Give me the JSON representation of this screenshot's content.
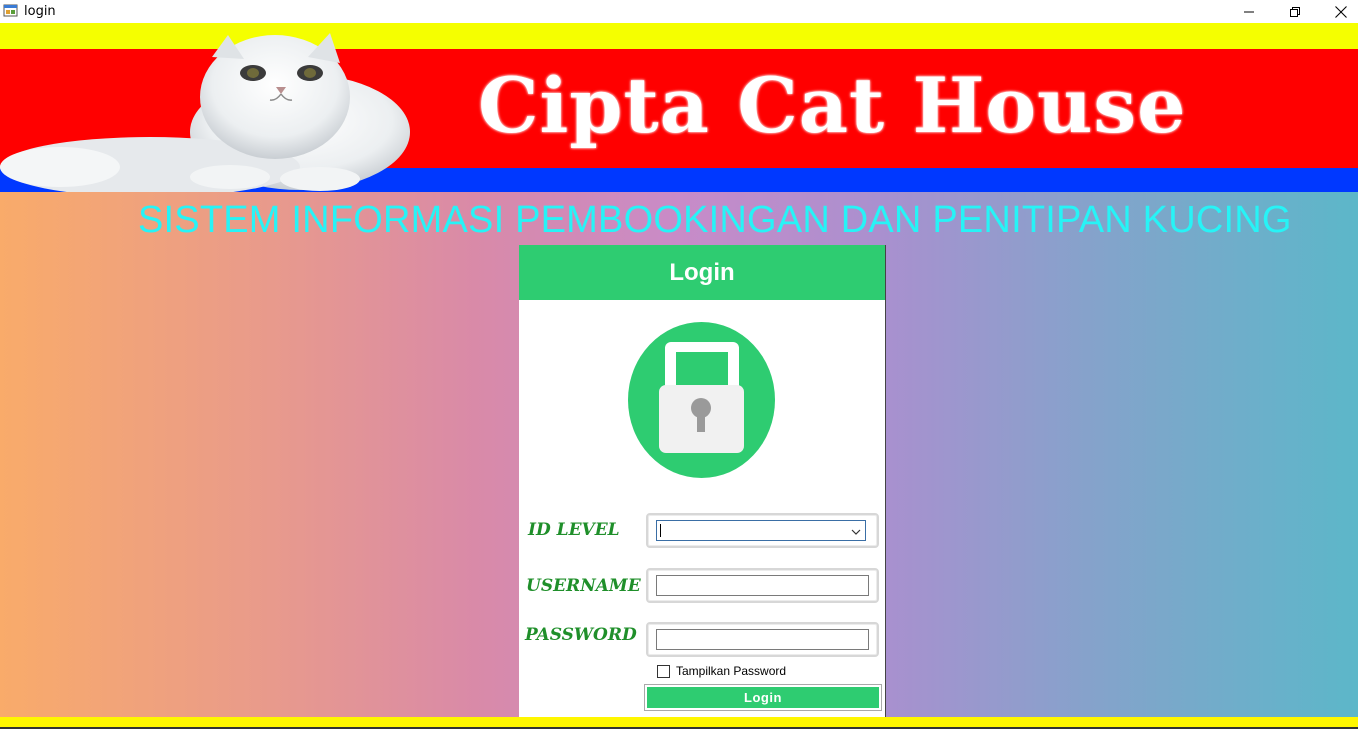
{
  "window": {
    "title": "login",
    "icons": {
      "app": "app-form-icon",
      "minimize": "minimize-icon",
      "maximize": "restore-icon",
      "close": "close-icon"
    }
  },
  "banner": {
    "brand": "Cipta Cat House",
    "image": "persian-cat-photo",
    "colors": {
      "top": "#f5ff00",
      "middle": "#ff0000",
      "bottom": "#0038ff"
    }
  },
  "subtitle": "SISTEM INFORMASI PEMBOOKINGAN DAN PENITIPAN KUCING",
  "login_panel": {
    "header": "Login",
    "icon": "padlock-icon",
    "accent": "#2ecc71",
    "fields": {
      "id_level": {
        "label": "ID LEVEL",
        "value": ""
      },
      "username": {
        "label": "USERNAME",
        "value": ""
      },
      "password": {
        "label": "PASSWORD",
        "value": ""
      }
    },
    "show_password": {
      "label": "Tampilkan Password",
      "checked": false
    },
    "submit_label": "Login"
  }
}
